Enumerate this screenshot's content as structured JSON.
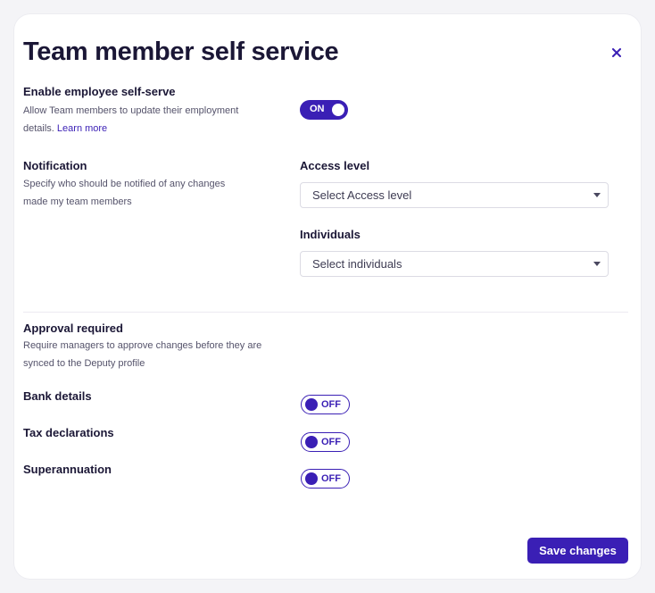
{
  "modal": {
    "title": "Team member self service",
    "close_icon": "close-icon"
  },
  "self_serve": {
    "heading": "Enable employee self-serve",
    "description": "Allow Team members to update their employment details.",
    "learn_more": "Learn more",
    "toggle_label": "ON",
    "enabled": true
  },
  "notification": {
    "heading": "Notification",
    "description": "Specify who should be notified of any changes made my team members",
    "access_level": {
      "label": "Access level",
      "placeholder": "Select Access level"
    },
    "individuals": {
      "label": "Individuals",
      "placeholder": "Select individuals"
    }
  },
  "approval": {
    "heading": "Approval required",
    "description": "Require managers to approve changes before they are synced to the Deputy profile",
    "items": [
      {
        "label": "Bank details",
        "toggle_label": "OFF",
        "enabled": false
      },
      {
        "label": "Tax declarations",
        "toggle_label": "OFF",
        "enabled": false
      },
      {
        "label": "Superannuation",
        "toggle_label": "OFF",
        "enabled": false
      }
    ]
  },
  "footer": {
    "save_label": "Save changes"
  },
  "colors": {
    "accent": "#3a1fb5",
    "text": "#1b1736",
    "muted": "#55536b"
  }
}
